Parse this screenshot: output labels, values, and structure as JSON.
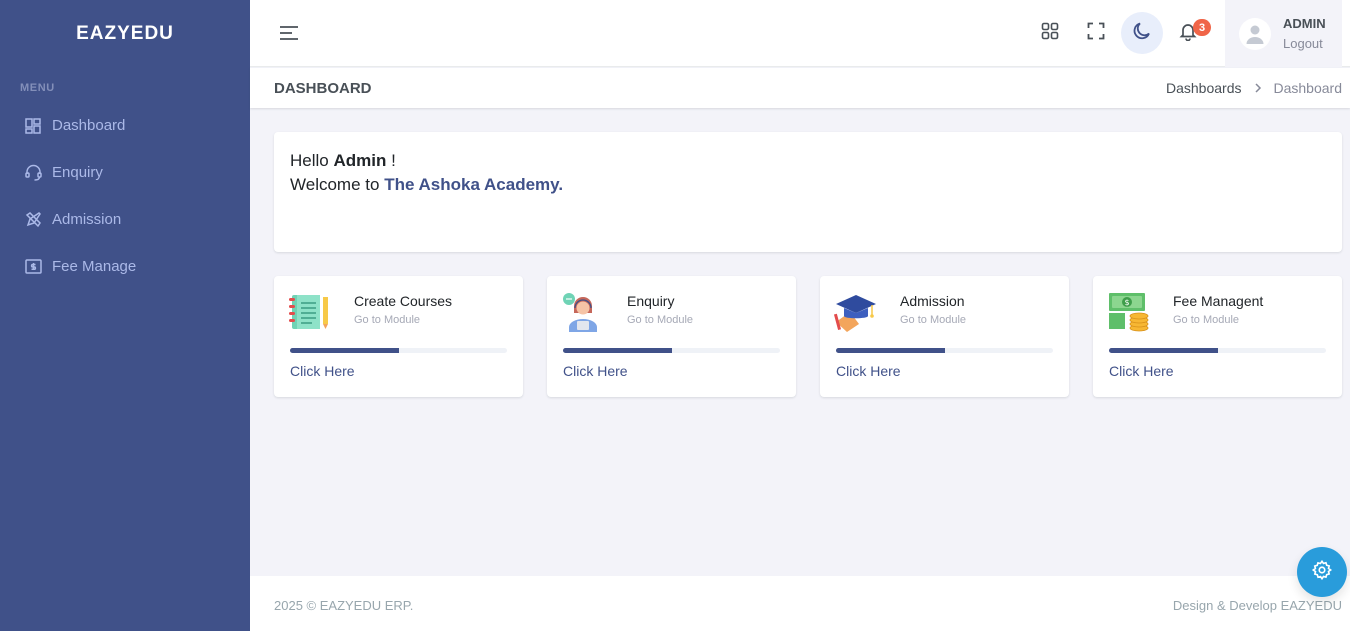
{
  "brand": "EAZYEDU",
  "sidebar": {
    "menu_title": "MENU",
    "items": [
      {
        "label": "Dashboard",
        "icon": "dashboard-icon"
      },
      {
        "label": "Enquiry",
        "icon": "headset-icon"
      },
      {
        "label": "Admission",
        "icon": "pencil-ruler-icon"
      },
      {
        "label": "Fee Manage",
        "icon": "money-icon"
      }
    ]
  },
  "topbar": {
    "notification_count": "3",
    "user_name": "ADMIN",
    "logout_label": "Logout"
  },
  "page": {
    "title": "DASHBOARD",
    "breadcrumb": [
      "Dashboards",
      "Dashboard"
    ]
  },
  "welcome": {
    "hello": "Hello",
    "name": "Admin",
    "exclaim": "!",
    "welcome_to": "Welcome to",
    "academy": "The Ashoka Academy."
  },
  "modules": [
    {
      "title": "Create Courses",
      "subtitle": "Go to Module",
      "link": "Click Here",
      "progress": 0.5,
      "icon": "notebook-icon"
    },
    {
      "title": "Enquiry",
      "subtitle": "Go to Module",
      "link": "Click Here",
      "progress": 0.5,
      "icon": "support-agent-icon"
    },
    {
      "title": "Admission",
      "subtitle": "Go to Module",
      "link": "Click Here",
      "progress": 0.5,
      "icon": "graduation-cap-icon"
    },
    {
      "title": "Fee Managent",
      "subtitle": "Go to Module",
      "link": "Click Here",
      "progress": 0.5,
      "icon": "money-coins-icon"
    }
  ],
  "footer": {
    "left": "2025 © EAZYEDU ERP.",
    "right": "Design & Develop EAZYEDU"
  },
  "colors": {
    "sidebar_bg": "#405189",
    "accent": "#405189",
    "badge": "#f06548",
    "fab": "#299cdb"
  }
}
